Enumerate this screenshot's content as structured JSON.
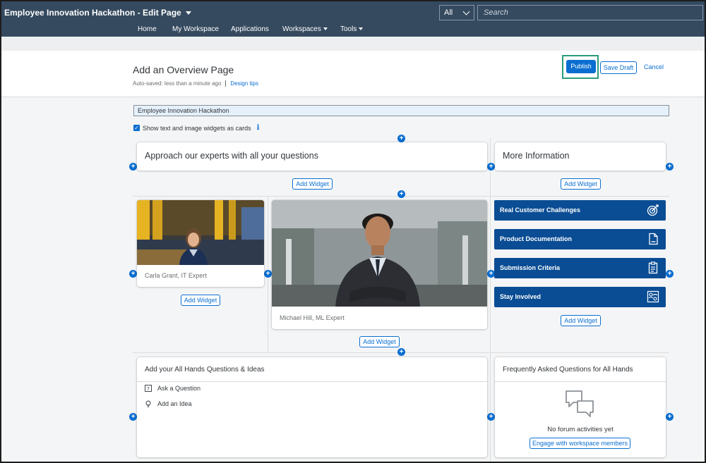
{
  "shell": {
    "title": "Employee Innovation Hackathon - Edit Page",
    "scope": "All",
    "search_placeholder": "Search",
    "nav": [
      "Home",
      "My Workspace",
      "Applications",
      "Workspaces",
      "Tools"
    ]
  },
  "header": {
    "title": "Add an Overview Page",
    "autosave": "Auto-saved: less than a minute ago",
    "design_tips": "Design tips",
    "publish": "Publish",
    "save_draft": "Save Draft",
    "cancel": "Cancel"
  },
  "page_name_value": "Employee Innovation Hackathon",
  "cards_option": {
    "label": "Show text and image widgets as cards",
    "checked": true
  },
  "add_widget": "Add Widget",
  "sections": {
    "top_left_title": "Approach our experts with all your questions",
    "top_right_title": "More Information"
  },
  "experts": [
    {
      "caption": "Carla Grant, IT Expert"
    },
    {
      "caption": "Michael Hill, ML Expert"
    }
  ],
  "links": [
    {
      "label": "Real Customer Challenges",
      "icon": "target-icon"
    },
    {
      "label": "Product Documentation",
      "icon": "document-icon"
    },
    {
      "label": "Submission Criteria",
      "icon": "clipboard-icon"
    },
    {
      "label": "Stay Involved",
      "icon": "people-network-icon"
    }
  ],
  "questions_card": {
    "title": "Add your All Hands Questions & Ideas",
    "items": [
      {
        "label": "Ask a Question",
        "icon": "question-icon"
      },
      {
        "label": "Add an Idea",
        "icon": "lightbulb-icon"
      }
    ]
  },
  "faq_card": {
    "title": "Frequently Asked Questions for All Hands",
    "empty_text": "No forum activities yet",
    "engage": "Engage with workspace members"
  },
  "colors": {
    "shell": "#354a5f",
    "accent": "#0a6ed1",
    "tile": "#0a4d94",
    "highlight": "#2b9c7a"
  }
}
